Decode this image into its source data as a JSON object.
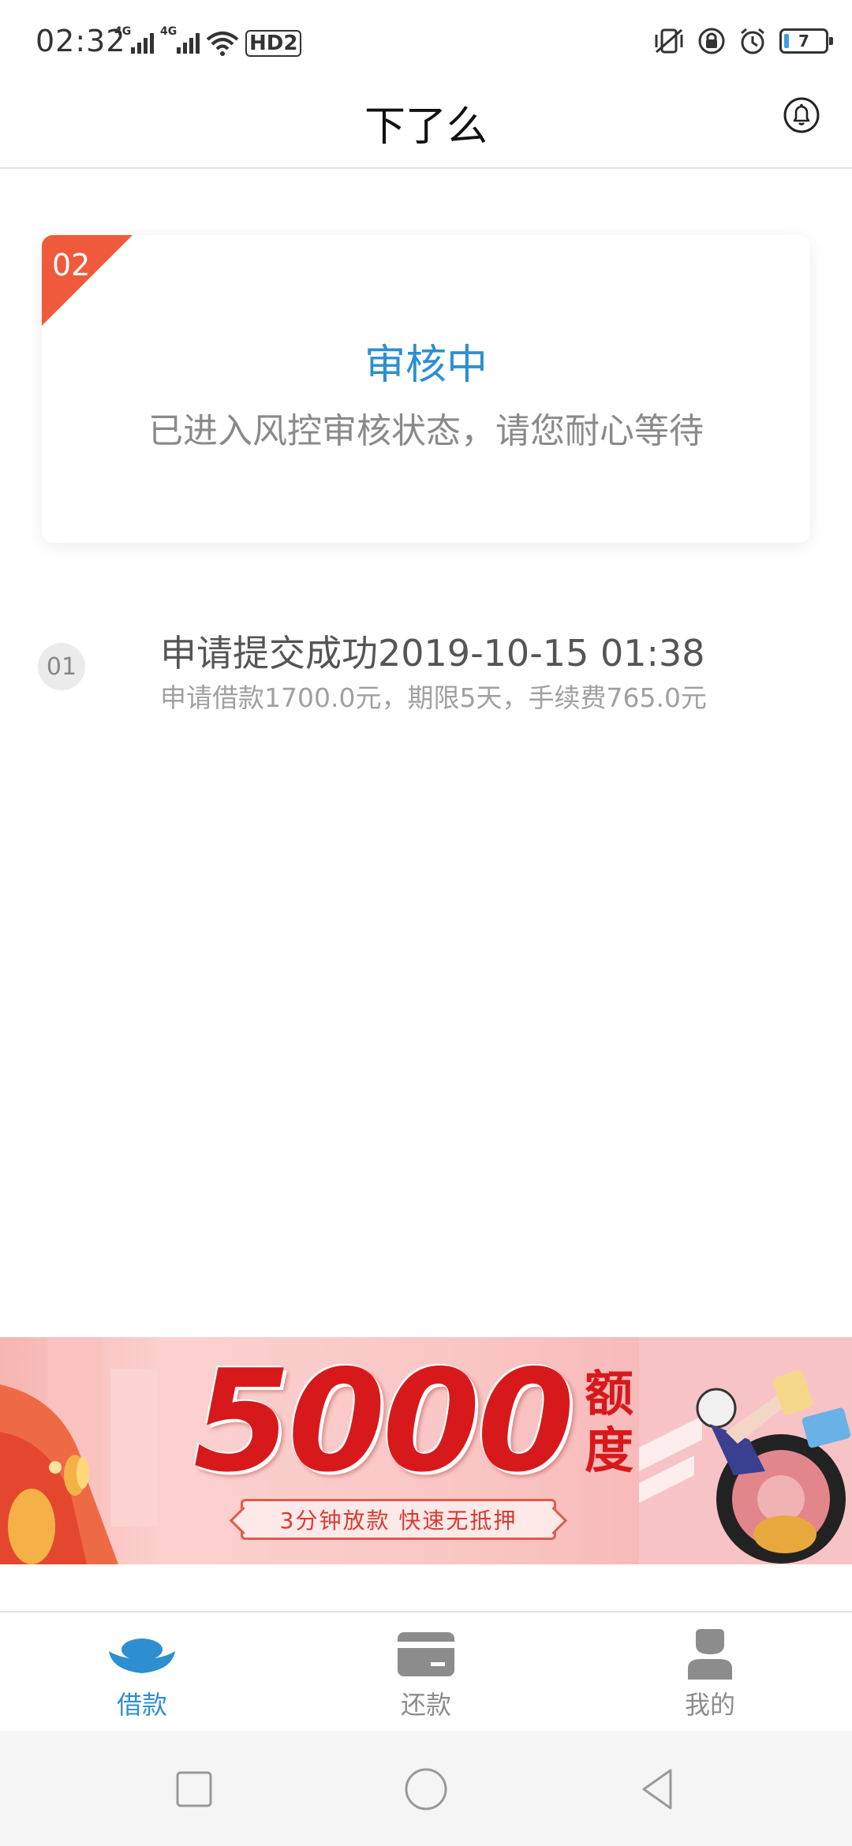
{
  "status_bar": {
    "time": "02:32",
    "network_1": "4G",
    "network_2": "4G",
    "hd_label": "HD2",
    "battery": "7",
    "icons": [
      "signal-icon",
      "signal-icon",
      "wifi-icon",
      "vibrate-icon",
      "lock-rotation-icon",
      "alarm-icon",
      "battery-icon"
    ]
  },
  "header": {
    "title": "下了么",
    "bell_icon": "bell-icon"
  },
  "status_card": {
    "step": "02",
    "title": "审核中",
    "description": "已进入风控审核状态，请您耐心等待"
  },
  "timeline": [
    {
      "step": "01",
      "title": "申请提交成功2019-10-15 01:38",
      "description": "申请借款1700.0元，期限5天，手续费765.0元"
    }
  ],
  "banner": {
    "amount": "5000",
    "unit": "额度",
    "subtitle": "3分钟放款 快速无抵押"
  },
  "tab_bar": {
    "tabs": [
      {
        "label": "借款",
        "icon": "ingot-icon",
        "active": true
      },
      {
        "label": "还款",
        "icon": "card-icon",
        "active": false
      },
      {
        "label": "我的",
        "icon": "user-icon",
        "active": false
      }
    ]
  },
  "colors": {
    "accent": "#2d8fd0",
    "corner_badge": "#f05a3c",
    "banner_red": "#d8191b"
  },
  "system_nav": {
    "buttons": [
      "recents-square-icon",
      "home-circle-icon",
      "back-triangle-icon"
    ]
  }
}
